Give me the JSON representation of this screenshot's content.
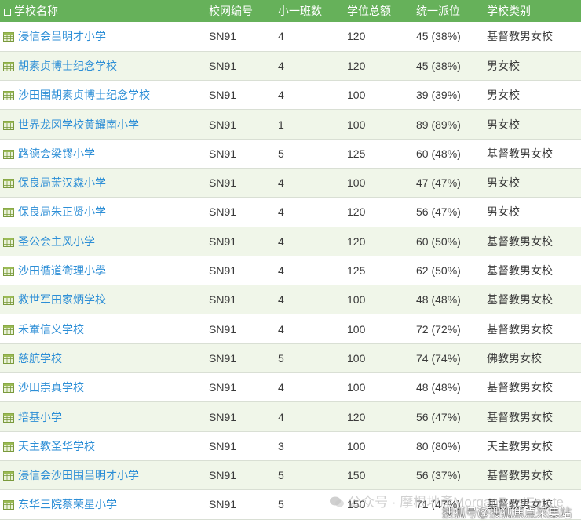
{
  "table": {
    "headers": [
      "学校名称",
      "校网编号",
      "小一班数",
      "学位总额",
      "统一派位",
      "学校类别"
    ],
    "rows": [
      {
        "name": "浸信会吕明才小学",
        "net": "SN91",
        "classes": "4",
        "places": "120",
        "allocation": "45 (38%)",
        "category": "基督教男女校"
      },
      {
        "name": "胡素贞博士纪念学校",
        "net": "SN91",
        "classes": "4",
        "places": "120",
        "allocation": "45 (38%)",
        "category": "男女校"
      },
      {
        "name": "沙田围胡素贞博士纪念学校",
        "net": "SN91",
        "classes": "4",
        "places": "100",
        "allocation": "39 (39%)",
        "category": "男女校"
      },
      {
        "name": "世界龙冈学校黄耀南小学",
        "net": "SN91",
        "classes": "1",
        "places": "100",
        "allocation": "89 (89%)",
        "category": "男女校"
      },
      {
        "name": "路德会梁镠小学",
        "net": "SN91",
        "classes": "5",
        "places": "125",
        "allocation": "60 (48%)",
        "category": "基督教男女校"
      },
      {
        "name": "保良局萧汉森小学",
        "net": "SN91",
        "classes": "4",
        "places": "100",
        "allocation": "47 (47%)",
        "category": "男女校"
      },
      {
        "name": "保良局朱正贤小学",
        "net": "SN91",
        "classes": "4",
        "places": "120",
        "allocation": "56 (47%)",
        "category": "男女校"
      },
      {
        "name": "圣公会主风小学",
        "net": "SN91",
        "classes": "4",
        "places": "120",
        "allocation": "60 (50%)",
        "category": "基督教男女校"
      },
      {
        "name": "沙田循道衛理小學",
        "net": "SN91",
        "classes": "4",
        "places": "125",
        "allocation": "62 (50%)",
        "category": "基督教男女校"
      },
      {
        "name": "救世军田家炳学校",
        "net": "SN91",
        "classes": "4",
        "places": "100",
        "allocation": "48 (48%)",
        "category": "基督教男女校"
      },
      {
        "name": "禾輋信义学校",
        "net": "SN91",
        "classes": "4",
        "places": "100",
        "allocation": "72 (72%)",
        "category": "基督教男女校"
      },
      {
        "name": "慈航学校",
        "net": "SN91",
        "classes": "5",
        "places": "100",
        "allocation": "74 (74%)",
        "category": "佛教男女校"
      },
      {
        "name": "沙田崇真学校",
        "net": "SN91",
        "classes": "4",
        "places": "100",
        "allocation": "48 (48%)",
        "category": "基督教男女校"
      },
      {
        "name": "培基小学",
        "net": "SN91",
        "classes": "4",
        "places": "120",
        "allocation": "56 (47%)",
        "category": "基督教男女校"
      },
      {
        "name": "天主教圣华学校",
        "net": "SN91",
        "classes": "3",
        "places": "100",
        "allocation": "80 (80%)",
        "category": "天主教男女校"
      },
      {
        "name": "浸信会沙田围吕明才小学",
        "net": "SN91",
        "classes": "5",
        "places": "150",
        "allocation": "56 (37%)",
        "category": "基督教男女校"
      },
      {
        "name": "东华三院蔡荣星小学",
        "net": "SN91",
        "classes": "5",
        "places": "150",
        "allocation": "71 (47%)",
        "category": "基督教男女校"
      }
    ]
  },
  "watermark": "公众号 · 摩根地產MorganRealEstate",
  "source_label": "搜狐号@搜狐焦点采集站",
  "colors": {
    "header_bg": "#66b15a",
    "link": "#2c8ed6",
    "row_alt": "#f0f6e9",
    "icon": "#7a9a3c"
  },
  "icons": {
    "header": "checkbox-icon",
    "row": "spreadsheet-icon",
    "watermark": "wechat-icon"
  }
}
